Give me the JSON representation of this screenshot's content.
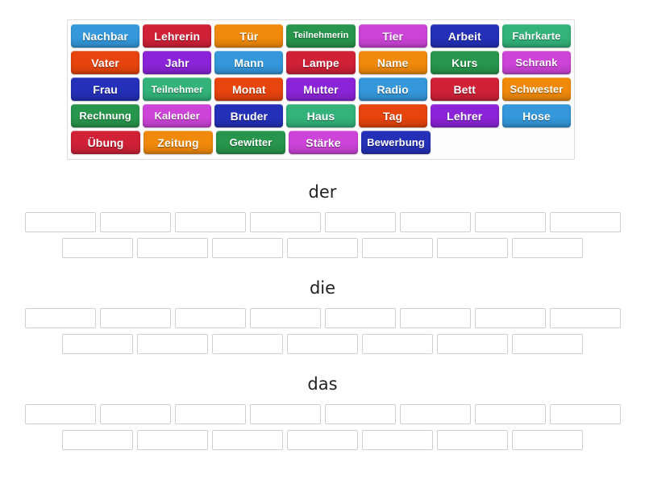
{
  "activity": {
    "type": "group-sort",
    "title_hidden": true
  },
  "wordbank": {
    "name": "word-bank",
    "rows": [
      [
        {
          "label": "Nachbar",
          "color": "#3498db",
          "size": "normal"
        },
        {
          "label": "Lehrerin",
          "color": "#d02137",
          "size": "normal"
        },
        {
          "label": "Tür",
          "color": "#f18a0a",
          "size": "normal"
        },
        {
          "label": "Teilnehmerin",
          "color": "#27964c",
          "size": "sm"
        },
        {
          "label": "Tier",
          "color": "#cc44d8",
          "size": "normal"
        },
        {
          "label": "Arbeit",
          "color": "#2430b8",
          "size": "normal"
        },
        {
          "label": "Fahrkarte",
          "color": "#33b37a",
          "size": "sm3"
        }
      ],
      [
        {
          "label": "Vater",
          "color": "#e8440d",
          "size": "normal"
        },
        {
          "label": "Jahr",
          "color": "#8b24d8",
          "size": "normal"
        },
        {
          "label": "Mann",
          "color": "#3498db",
          "size": "normal"
        },
        {
          "label": "Lampe",
          "color": "#d02137",
          "size": "normal"
        },
        {
          "label": "Name",
          "color": "#f18a0a",
          "size": "normal"
        },
        {
          "label": "Kurs",
          "color": "#27964c",
          "size": "normal"
        },
        {
          "label": "Schrank",
          "color": "#cc44d8",
          "size": "sm3"
        }
      ],
      [
        {
          "label": "Frau",
          "color": "#2430b8",
          "size": "normal"
        },
        {
          "label": "Teilnehmer",
          "color": "#33b37a",
          "size": "sm2"
        },
        {
          "label": "Monat",
          "color": "#e8440d",
          "size": "normal"
        },
        {
          "label": "Mutter",
          "color": "#8b24d8",
          "size": "normal"
        },
        {
          "label": "Radio",
          "color": "#3498db",
          "size": "normal"
        },
        {
          "label": "Bett",
          "color": "#d02137",
          "size": "normal"
        },
        {
          "label": "Schwester",
          "color": "#f18a0a",
          "size": "sm3"
        }
      ],
      [
        {
          "label": "Rechnung",
          "color": "#27964c",
          "size": "sm3"
        },
        {
          "label": "Kalender",
          "color": "#cc44d8",
          "size": "sm3"
        },
        {
          "label": "Bruder",
          "color": "#2430b8",
          "size": "normal"
        },
        {
          "label": "Haus",
          "color": "#33b37a",
          "size": "normal"
        },
        {
          "label": "Tag",
          "color": "#e8440d",
          "size": "normal"
        },
        {
          "label": "Lehrer",
          "color": "#8b24d8",
          "size": "normal"
        },
        {
          "label": "Hose",
          "color": "#3498db",
          "size": "normal"
        }
      ],
      [
        {
          "label": "Übung",
          "color": "#d02137",
          "size": "normal"
        },
        {
          "label": "Zeitung",
          "color": "#f18a0a",
          "size": "normal"
        },
        {
          "label": "Gewitter",
          "color": "#27964c",
          "size": "sm3"
        },
        {
          "label": "Stärke",
          "color": "#cc44d8",
          "size": "normal"
        },
        {
          "label": "Bewerbung",
          "color": "#2430b8",
          "size": "sm3"
        }
      ]
    ]
  },
  "sections": [
    {
      "id": "der",
      "title": "der",
      "rows": [
        {
          "slots": [
            "",
            "",
            "",
            "",
            "",
            "",
            "",
            ""
          ]
        },
        {
          "slots": [
            "",
            "",
            "",
            "",
            "",
            "",
            ""
          ]
        }
      ]
    },
    {
      "id": "die",
      "title": "die",
      "rows": [
        {
          "slots": [
            "",
            "",
            "",
            "",
            "",
            "",
            "",
            ""
          ]
        },
        {
          "slots": [
            "",
            "",
            "",
            "",
            "",
            "",
            ""
          ]
        }
      ]
    },
    {
      "id": "das",
      "title": "das",
      "rows": [
        {
          "slots": [
            "",
            "",
            "",
            "",
            "",
            "",
            "",
            ""
          ]
        },
        {
          "slots": [
            "",
            "",
            "",
            "",
            "",
            "",
            ""
          ]
        }
      ]
    }
  ]
}
